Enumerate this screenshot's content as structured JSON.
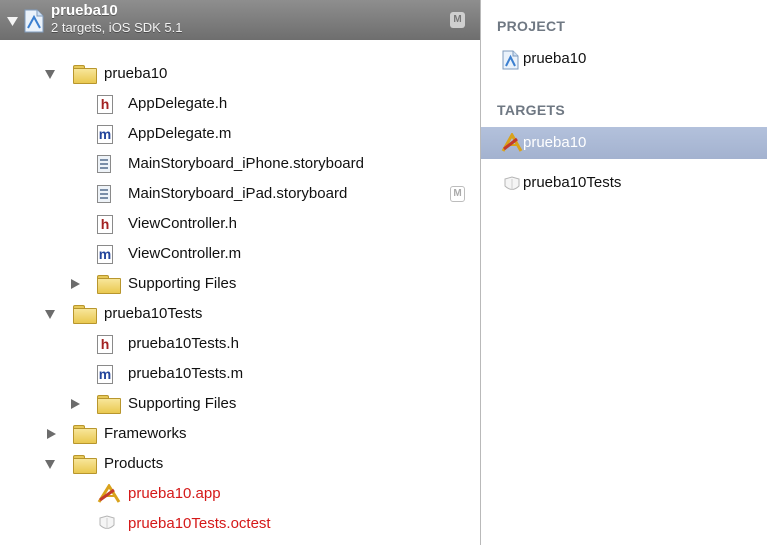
{
  "project": {
    "name": "prueba10",
    "subtitle": "2 targets, iOS SDK 5.1",
    "badge": "M"
  },
  "tree": [
    {
      "label": "prueba10",
      "icon": "folder-icon",
      "expand": "expanded",
      "level": 1
    },
    {
      "label": "AppDelegate.h",
      "icon": "h-file-icon",
      "level": 2
    },
    {
      "label": "AppDelegate.m",
      "icon": "m-file-icon",
      "level": 2
    },
    {
      "label": "MainStoryboard_iPhone.storyboard",
      "icon": "storyboard-icon",
      "level": 2
    },
    {
      "label": "MainStoryboard_iPad.storyboard",
      "icon": "storyboard-icon",
      "level": 2,
      "badge": "M"
    },
    {
      "label": "ViewController.h",
      "icon": "h-file-icon",
      "level": 2
    },
    {
      "label": "ViewController.m",
      "icon": "m-file-icon",
      "level": 2
    },
    {
      "label": "Supporting Files",
      "icon": "folder-icon",
      "expand": "collapsed",
      "level": 2
    },
    {
      "label": "prueba10Tests",
      "icon": "folder-icon",
      "expand": "expanded",
      "level": 1
    },
    {
      "label": "prueba10Tests.h",
      "icon": "h-file-icon",
      "level": 2
    },
    {
      "label": "prueba10Tests.m",
      "icon": "m-file-icon",
      "level": 2
    },
    {
      "label": "Supporting Files",
      "icon": "folder-icon",
      "expand": "collapsed",
      "level": 2
    },
    {
      "label": "Frameworks",
      "icon": "folder-icon",
      "expand": "collapsed",
      "level": 1
    },
    {
      "label": "Products",
      "icon": "folder-icon",
      "expand": "expanded",
      "level": 1
    },
    {
      "label": "prueba10.app",
      "icon": "app-icon",
      "level": 2,
      "missing": true
    },
    {
      "label": "prueba10Tests.octest",
      "icon": "octest-bundle-icon",
      "level": 2,
      "missing": true
    }
  ],
  "panel": {
    "project_heading": "PROJECT",
    "project_item": "prueba10",
    "targets_heading": "TARGETS",
    "targets": [
      {
        "label": "prueba10",
        "icon": "app-target-icon",
        "selected": true
      },
      {
        "label": "prueba10Tests",
        "icon": "test-target-icon",
        "selected": false
      }
    ]
  },
  "colors": {
    "missing_text": "#d51919",
    "selection": "#a3b2cf",
    "section_heading": "#6f7883"
  }
}
